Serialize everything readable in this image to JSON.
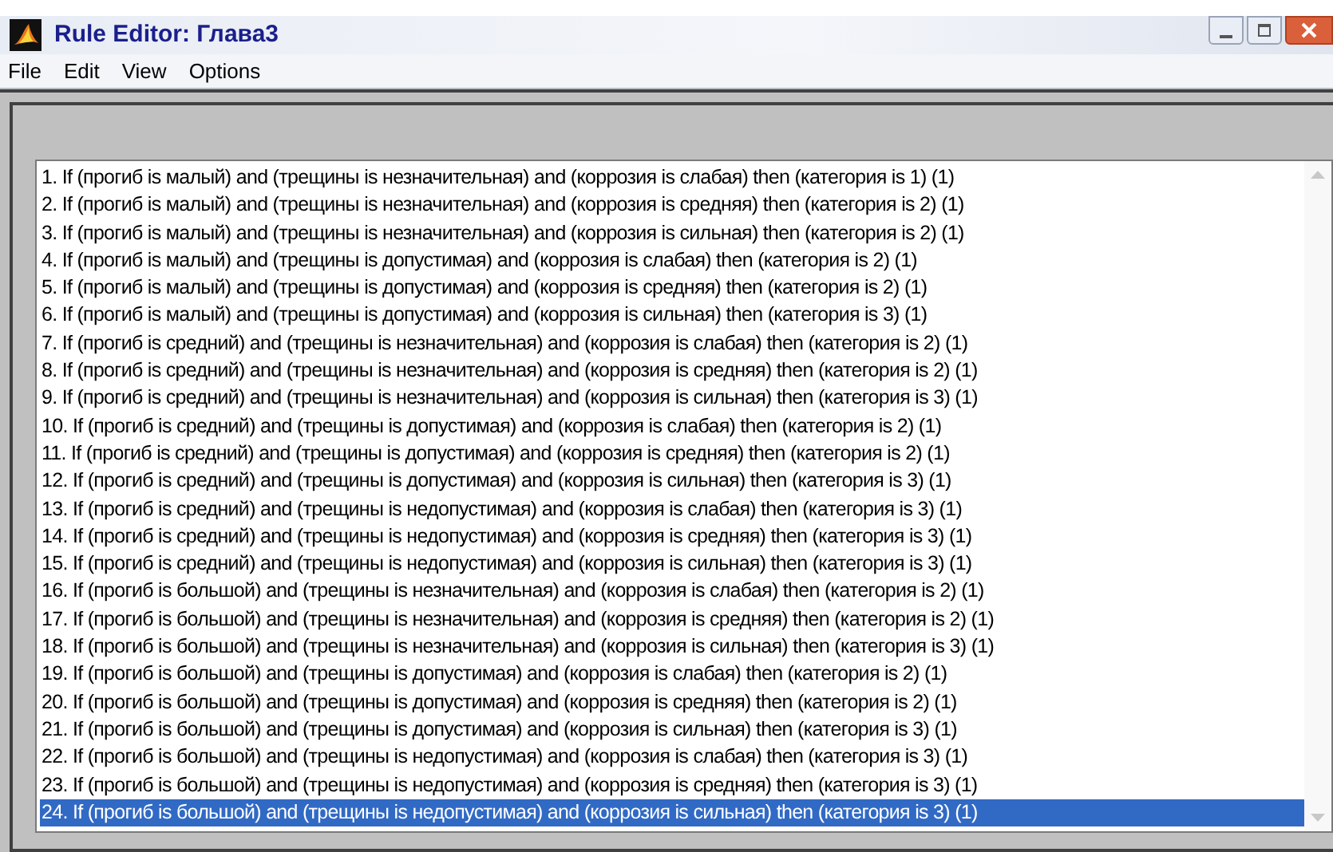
{
  "window": {
    "title": "Rule Editor: Глава3"
  },
  "menu": [
    "File",
    "Edit",
    "View",
    "Options"
  ],
  "rules": [
    {
      "text": "1. If (прогиб is малый) and (трещины is незначительная) and (коррозия is слабая) then (категория is 1) (1)",
      "selected": false
    },
    {
      "text": "2. If (прогиб is малый) and (трещины is незначительная) and (коррозия is средняя) then (категория is 2) (1)",
      "selected": false
    },
    {
      "text": "3. If (прогиб is малый) and (трещины is незначительная) and (коррозия is сильная) then (категория is 2) (1)",
      "selected": false
    },
    {
      "text": "4. If (прогиб is малый) and (трещины is допустимая) and (коррозия is слабая) then (категория is 2) (1)",
      "selected": false
    },
    {
      "text": "5. If (прогиб is малый) and (трещины is допустимая) and (коррозия is средняя) then (категория is 2) (1)",
      "selected": false
    },
    {
      "text": "6. If (прогиб is малый) and (трещины is допустимая) and (коррозия is сильная) then (категория is 3) (1)",
      "selected": false
    },
    {
      "text": "7. If (прогиб is средний) and (трещины is незначительная) and (коррозия is слабая) then (категория is 2) (1)",
      "selected": false
    },
    {
      "text": "8. If (прогиб is средний) and (трещины is незначительная) and (коррозия is средняя) then (категория is 2) (1)",
      "selected": false
    },
    {
      "text": "9. If (прогиб is средний) and (трещины is незначительная) and (коррозия is сильная) then (категория is 3) (1)",
      "selected": false
    },
    {
      "text": "10. If (прогиб is средний) and (трещины is допустимая) and (коррозия is слабая) then (категория is 2) (1)",
      "selected": false
    },
    {
      "text": "11. If (прогиб is средний) and (трещины is допустимая) and (коррозия is средняя) then (категория is 2) (1)",
      "selected": false
    },
    {
      "text": "12. If (прогиб is средний) and (трещины is допустимая) and (коррозия is сильная) then (категория is 3) (1)",
      "selected": false
    },
    {
      "text": "13. If (прогиб is средний) and (трещины is недопустимая) and (коррозия is слабая) then (категория is 3) (1)",
      "selected": false
    },
    {
      "text": "14. If (прогиб is средний) and (трещины is недопустимая) and (коррозия is средняя) then (категория is 3) (1)",
      "selected": false
    },
    {
      "text": "15. If (прогиб is средний) and (трещины is недопустимая) and (коррозия is сильная) then (категория is 3) (1)",
      "selected": false
    },
    {
      "text": "16. If (прогиб is большой) and (трещины is незначительная) and (коррозия is слабая) then (категория is 2) (1)",
      "selected": false
    },
    {
      "text": "17. If (прогиб is большой) and (трещины is незначительная) and (коррозия is средняя) then (категория is 2) (1)",
      "selected": false
    },
    {
      "text": "18. If (прогиб is большой) and (трещины is незначительная) and (коррозия is сильная) then (категория is 3) (1)",
      "selected": false
    },
    {
      "text": "19. If (прогиб is большой) and (трещины is допустимая) and (коррозия is слабая) then (категория is 2) (1)",
      "selected": false
    },
    {
      "text": "20. If (прогиб is большой) and (трещины is допустимая) and (коррозия is средняя) then (категория is 2) (1)",
      "selected": false
    },
    {
      "text": "21. If (прогиб is большой) and (трещины is допустимая) and (коррозия is сильная) then (категория is 3) (1)",
      "selected": false
    },
    {
      "text": "22. If (прогиб is большой) and (трещины is недопустимая) and (коррозия is слабая) then (категория is 3) (1)",
      "selected": false
    },
    {
      "text": "23. If (прогиб is большой) and (трещины is недопустимая) and (коррозия is средняя) then (категория is 3) (1)",
      "selected": false
    },
    {
      "text": "24. If (прогиб is большой) and (трещины is недопустимая) and (коррозия is сильная) then (категория is 3) (1)",
      "selected": true
    }
  ]
}
